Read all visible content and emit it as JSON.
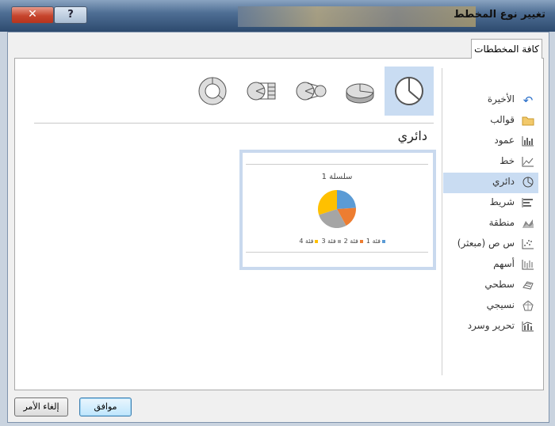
{
  "window": {
    "title": "تغيير نوع المخطط",
    "close_glyph": "✕",
    "help_glyph": "?"
  },
  "tab": {
    "label": "كافة المخططات"
  },
  "sidebar": {
    "items": [
      {
        "label": "الأخيرة",
        "icon": "undo-arrow-icon"
      },
      {
        "label": "قوالب",
        "icon": "folder-icon"
      },
      {
        "label": "عمود",
        "icon": "column-chart-icon"
      },
      {
        "label": "خط",
        "icon": "line-chart-icon"
      },
      {
        "label": "دائري",
        "icon": "pie-chart-icon",
        "selected": true
      },
      {
        "label": "شريط",
        "icon": "bar-chart-icon"
      },
      {
        "label": "منطقة",
        "icon": "area-chart-icon"
      },
      {
        "label": "س ص (مبعثر)",
        "icon": "scatter-chart-icon"
      },
      {
        "label": "أسهم",
        "icon": "stock-chart-icon"
      },
      {
        "label": "سطحي",
        "icon": "surface-chart-icon"
      },
      {
        "label": "نسيجي",
        "icon": "radar-chart-icon"
      },
      {
        "label": "تحرير وسرد",
        "icon": "combo-chart-icon"
      }
    ]
  },
  "chart_types": [
    "pie",
    "3d-pie",
    "pie-of-pie",
    "bar-of-pie",
    "doughnut"
  ],
  "main": {
    "heading": "دائري"
  },
  "preview": {
    "title": "سلسلة 1",
    "legend": [
      "فئة 1",
      "فئة 2",
      "فئة 3",
      "فئة 4"
    ],
    "colors": [
      "#5b9bd5",
      "#ed7d31",
      "#a5a5a5",
      "#ffc000"
    ]
  },
  "chart_data": {
    "type": "pie",
    "title": "سلسلة 1",
    "categories": [
      "فئة 1",
      "فئة 2",
      "فئة 3",
      "فئة 4"
    ],
    "values": [
      24,
      18,
      28,
      30
    ]
  },
  "buttons": {
    "ok": "موافق",
    "cancel": "إلغاء الأمر"
  }
}
